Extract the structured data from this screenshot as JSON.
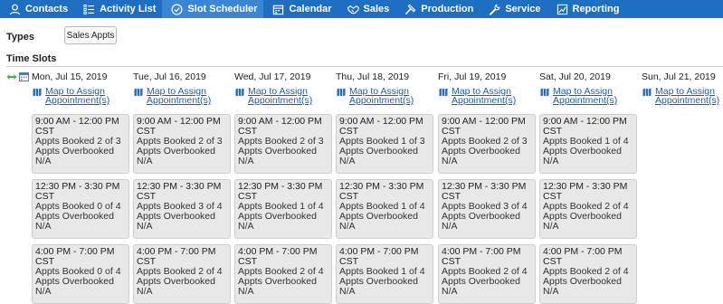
{
  "nav": {
    "items": [
      {
        "label": "Contacts",
        "icon": "user-icon"
      },
      {
        "label": "Activity List",
        "icon": "list-icon"
      },
      {
        "label": "Slot Scheduler",
        "icon": "check-circle-icon"
      },
      {
        "label": "Calendar",
        "icon": "calendar-icon"
      },
      {
        "label": "Sales",
        "icon": "handshake-icon"
      },
      {
        "label": "Production",
        "icon": "hammer-icon"
      },
      {
        "label": "Service",
        "icon": "wrench-icon"
      },
      {
        "label": "Reporting",
        "icon": "chart-icon"
      }
    ],
    "active_index": 2,
    "bar_color": "#1e6fc2"
  },
  "types": {
    "label": "Types",
    "button_label": "Sales Appts"
  },
  "timeslots": {
    "label": "Time Slots"
  },
  "map_link_line1": "Map to Assign",
  "map_link_line2": "Appointment(s)",
  "days": [
    {
      "date": "Mon, Jul 15, 2019"
    },
    {
      "date": "Tue, Jul 16, 2019"
    },
    {
      "date": "Wed, Jul 17, 2019"
    },
    {
      "date": "Thu, Jul 18, 2019"
    },
    {
      "date": "Fri, Jul 19, 2019"
    },
    {
      "date": "Sat, Jul 20, 2019"
    },
    {
      "date": "Sun, Jul 21, 2019"
    }
  ],
  "slots": [
    [
      {
        "time1": "9:00 AM - 12:00 PM",
        "time2": "CST",
        "booked": "Appts Booked 2 of 3",
        "overbooked": "Appts Overbooked N/A"
      },
      {
        "time1": "12:30 PM - 3:30 PM",
        "time2": "CST",
        "booked": "Appts Booked 0 of 4",
        "overbooked": "Appts Overbooked N/A"
      },
      {
        "time1": "4:00 PM - 7:00 PM CST",
        "time2": "",
        "booked": "Appts Booked 0 of 4",
        "overbooked": "Appts Overbooked N/A"
      }
    ],
    [
      {
        "time1": "9:00 AM - 12:00 PM",
        "time2": "CST",
        "booked": "Appts Booked 2 of 3",
        "overbooked": "Appts Overbooked N/A"
      },
      {
        "time1": "12:30 PM - 3:30 PM",
        "time2": "CST",
        "booked": "Appts Booked 3 of 4",
        "overbooked": "Appts Overbooked N/A"
      },
      {
        "time1": "4:00 PM - 7:00 PM CST",
        "time2": "",
        "booked": "Appts Booked 2 of 4",
        "overbooked": "Appts Overbooked N/A"
      }
    ],
    [
      {
        "time1": "9:00 AM - 12:00 PM",
        "time2": "CST",
        "booked": "Appts Booked 2 of 3",
        "overbooked": "Appts Overbooked N/A"
      },
      {
        "time1": "12:30 PM - 3:30 PM",
        "time2": "CST",
        "booked": "Appts Booked 1 of 4",
        "overbooked": "Appts Overbooked N/A"
      },
      {
        "time1": "4:00 PM - 7:00 PM CST",
        "time2": "",
        "booked": "Appts Booked 2 of 4",
        "overbooked": "Appts Overbooked N/A"
      }
    ],
    [
      {
        "time1": "9:00 AM - 12:00 PM",
        "time2": "CST",
        "booked": "Appts Booked 1 of 3",
        "overbooked": "Appts Overbooked N/A"
      },
      {
        "time1": "12:30 PM - 3:30 PM",
        "time2": "CST",
        "booked": "Appts Booked 1 of 4",
        "overbooked": "Appts Overbooked N/A"
      },
      {
        "time1": "4:00 PM - 7:00 PM CST",
        "time2": "",
        "booked": "Appts Booked 1 of 4",
        "overbooked": "Appts Overbooked N/A"
      }
    ],
    [
      {
        "time1": "9:00 AM - 12:00 PM",
        "time2": "CST",
        "booked": "Appts Booked 2 of 3",
        "overbooked": "Appts Overbooked N/A"
      },
      {
        "time1": "12:30 PM - 3:30 PM",
        "time2": "CST",
        "booked": "Appts Booked 3 of 4",
        "overbooked": "Appts Overbooked N/A"
      },
      {
        "time1": "4:00 PM - 7:00 PM CST",
        "time2": "",
        "booked": "Appts Booked 2 of 4",
        "overbooked": "Appts Overbooked N/A"
      }
    ],
    [
      {
        "time1": "9:00 AM - 12:00 PM",
        "time2": "CST",
        "booked": "Appts Booked 1 of 4",
        "overbooked": "Appts Overbooked N/A"
      },
      {
        "time1": "12:30 PM - 3:30 PM",
        "time2": "CST",
        "booked": "Appts Booked 2 of 4",
        "overbooked": "Appts Overbooked N/A"
      },
      {
        "time1": "4:00 PM - 7:00 PM CST",
        "time2": "",
        "booked": "Appts Booked 2 of 4",
        "overbooked": "Appts Overbooked N/A"
      }
    ]
  ]
}
